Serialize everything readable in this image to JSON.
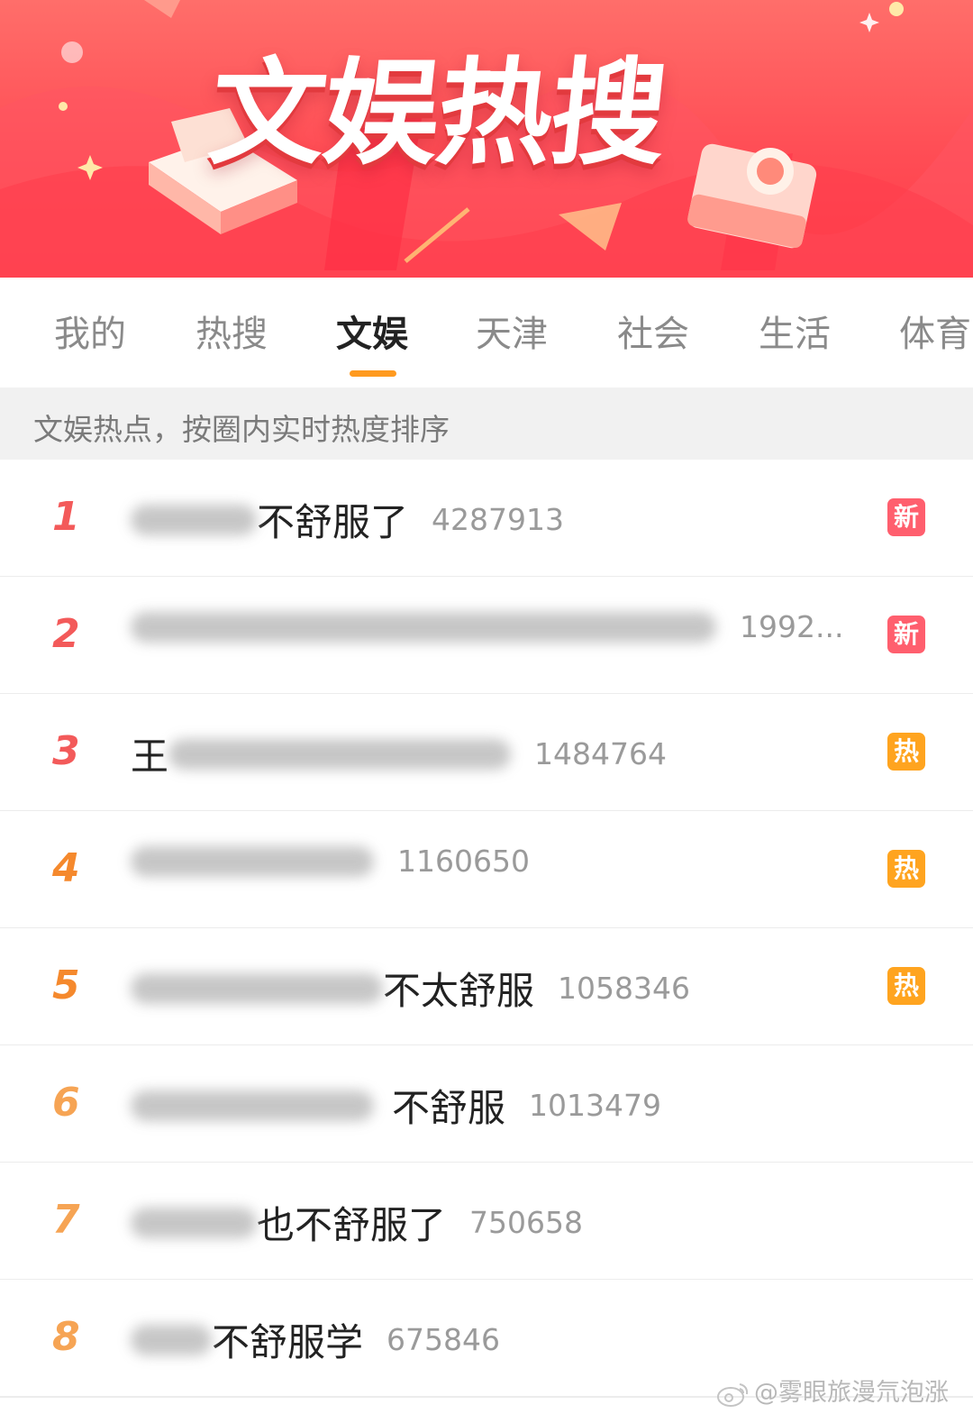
{
  "banner": {
    "title": "文娱热搜"
  },
  "tabs": [
    {
      "label": "我的",
      "active": false
    },
    {
      "label": "热搜",
      "active": false
    },
    {
      "label": "文娱",
      "active": true
    },
    {
      "label": "天津",
      "active": false
    },
    {
      "label": "社会",
      "active": false
    },
    {
      "label": "生活",
      "active": false
    },
    {
      "label": "体育",
      "active": false
    }
  ],
  "subheader": "文娱热点，按圈内实时热度排序",
  "rank_colors": {
    "top": "#f35a5a",
    "mid": "#f5892d",
    "low": "#f6a454"
  },
  "items": [
    {
      "rank": "1",
      "prefix_visible": "",
      "title": "不舒服了",
      "count": "4287913",
      "badge": "新"
    },
    {
      "rank": "2",
      "prefix_visible": "",
      "title": "",
      "count": "1992...",
      "badge": "新"
    },
    {
      "rank": "3",
      "prefix_visible": "王",
      "title": "",
      "count": "1484764",
      "badge": "热"
    },
    {
      "rank": "4",
      "prefix_visible": "",
      "title": "",
      "count": "1160650",
      "badge": "热"
    },
    {
      "rank": "5",
      "prefix_visible": "",
      "title": "不太舒服",
      "count": "1058346",
      "badge": "热"
    },
    {
      "rank": "6",
      "prefix_visible": "",
      "title": "不舒服",
      "count": "1013479",
      "badge": ""
    },
    {
      "rank": "7",
      "prefix_visible": "",
      "title": "也不舒服了",
      "count": "750658",
      "badge": ""
    },
    {
      "rank": "8",
      "prefix_visible": "",
      "title": "不舒服学",
      "count": "675846",
      "badge": ""
    }
  ],
  "watermark": "@雾眼旅漫氘泡涨"
}
